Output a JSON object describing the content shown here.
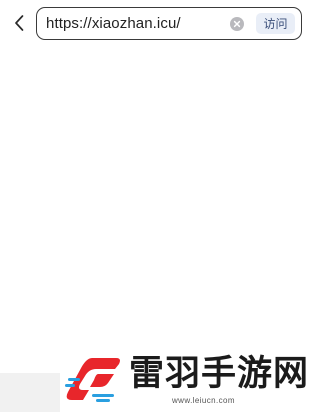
{
  "address_bar": {
    "url_value": "https://xiaozhan.icu/",
    "visit_label": "访问",
    "back_icon": "chevron-left-icon",
    "clear_icon": "clear-circle-icon"
  },
  "watermark": {
    "name": "雷羽手游网",
    "url": "www.leiucn.com",
    "logo_icon": "leiyu-logo-icon",
    "colors": {
      "logo_red": "#e8262b",
      "logo_blue": "#2a9fe0"
    }
  }
}
